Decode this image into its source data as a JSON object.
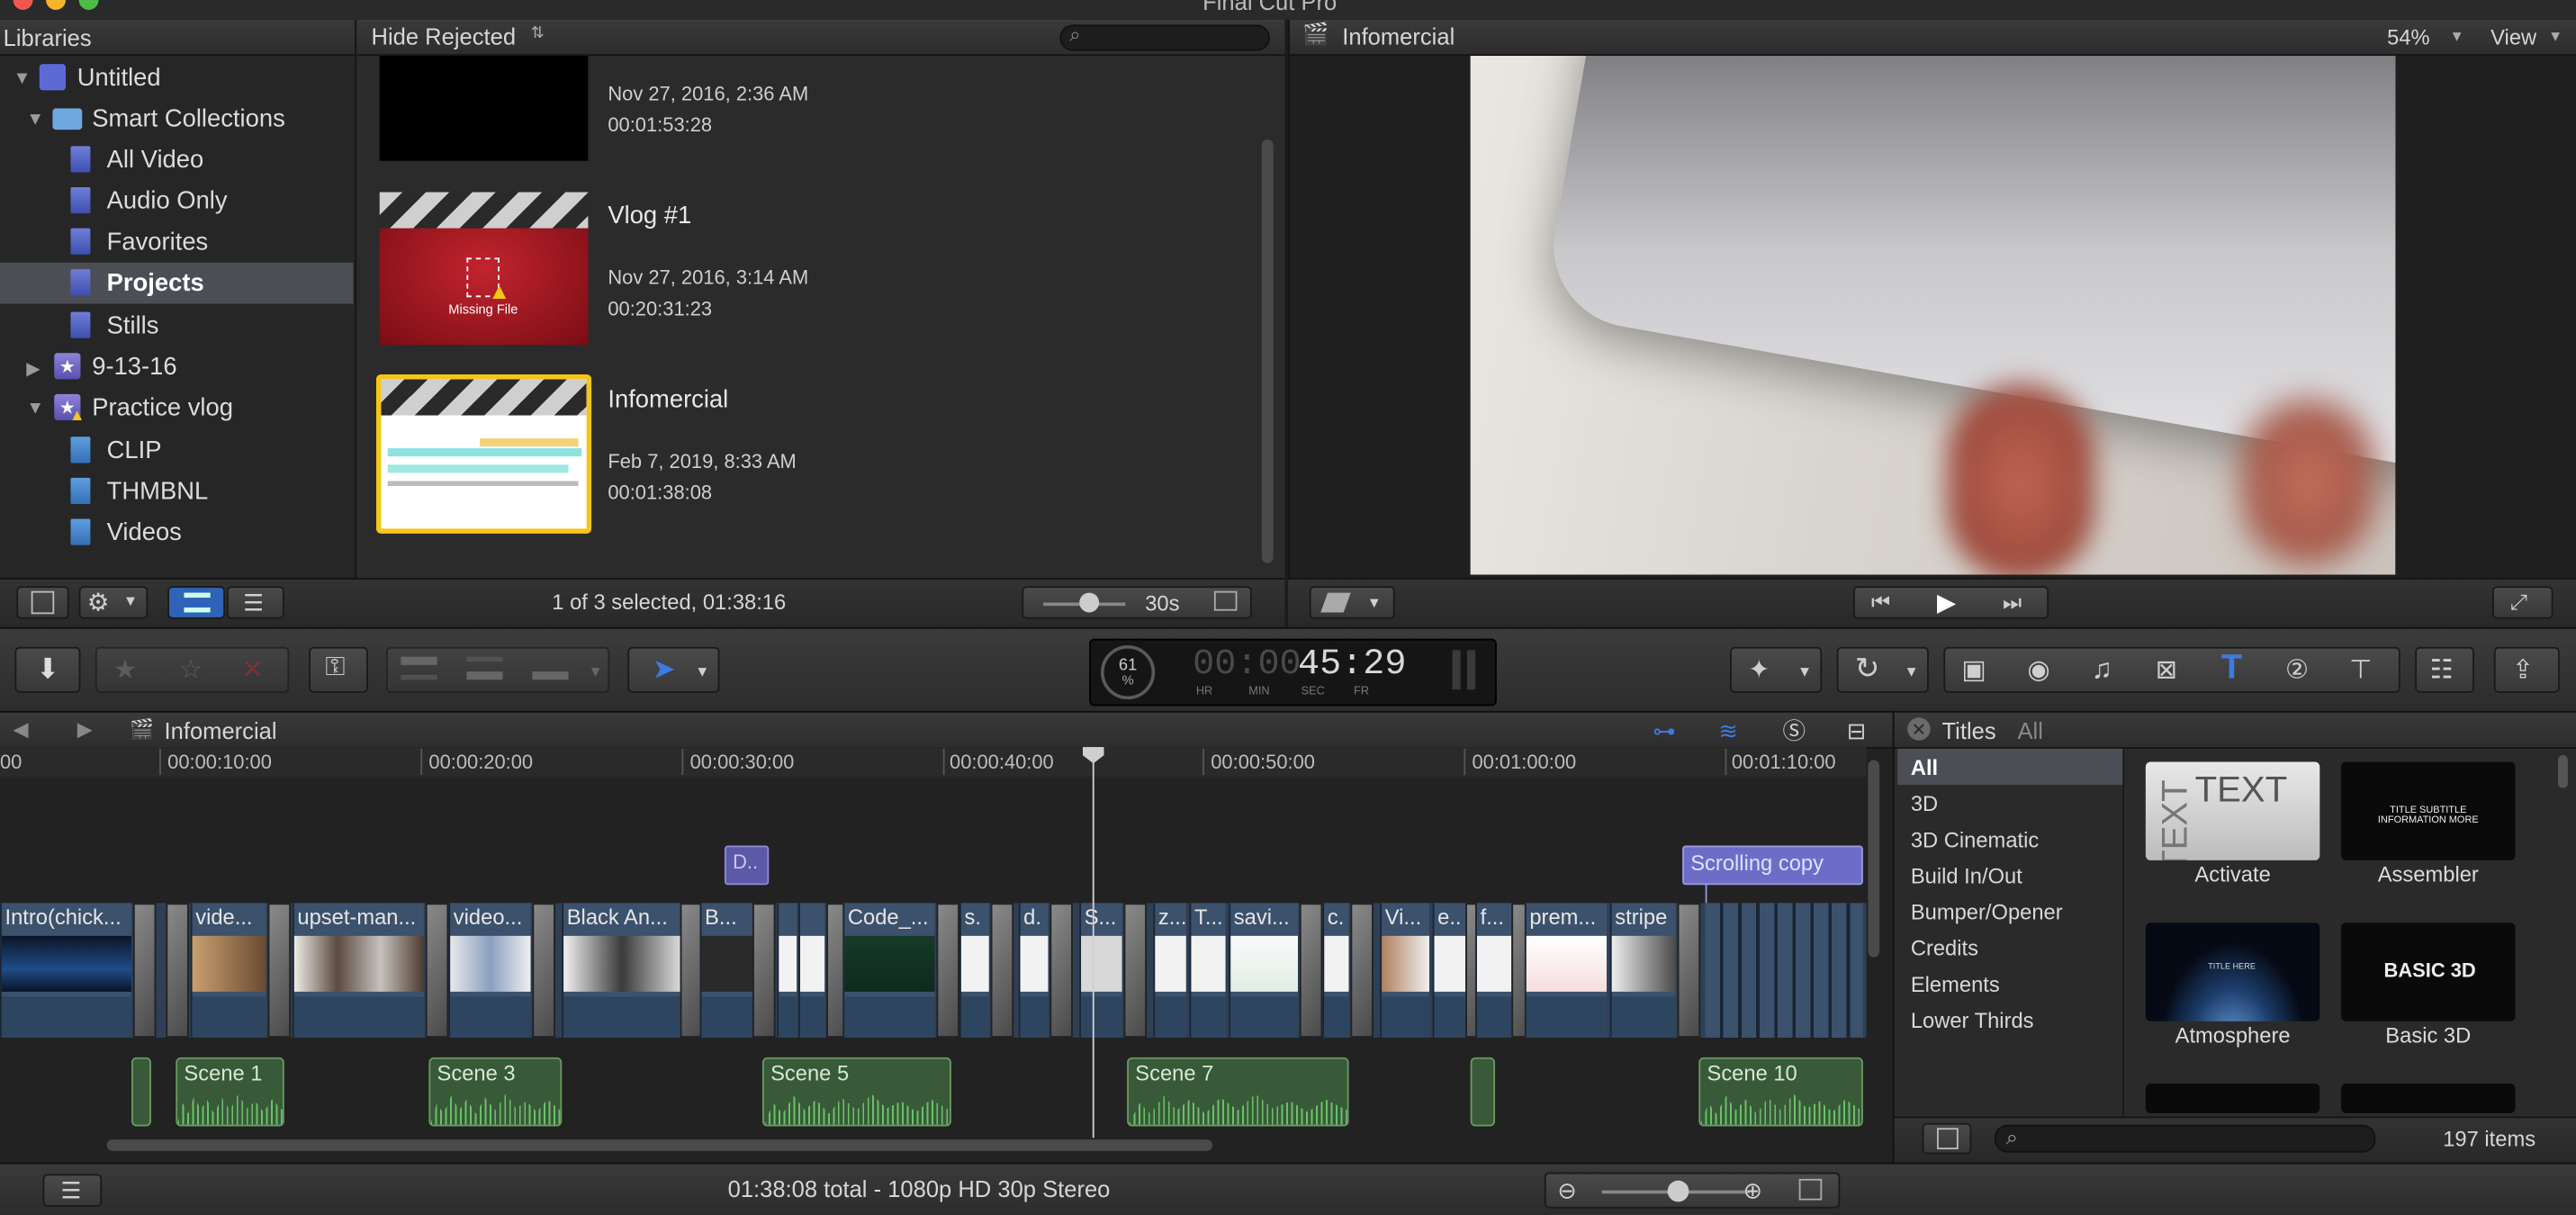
{
  "window": {
    "title": "Final Cut Pro"
  },
  "libraries": {
    "header": "Libraries",
    "items": [
      {
        "label": "Untitled"
      },
      {
        "label": "Smart Collections"
      },
      {
        "label": "All Video"
      },
      {
        "label": "Audio Only"
      },
      {
        "label": "Favorites"
      },
      {
        "label": "Projects"
      },
      {
        "label": "Stills"
      },
      {
        "label": "9-13-16"
      },
      {
        "label": "Practice vlog"
      },
      {
        "label": "CLIP"
      },
      {
        "label": "THMBNL"
      },
      {
        "label": "Videos"
      }
    ]
  },
  "browser": {
    "filter": "Hide Rejected",
    "clips": [
      {
        "name": "",
        "date": "Nov 27, 2016, 2:36 AM",
        "duration": "00:01:53:28"
      },
      {
        "name": "Vlog #1",
        "date": "Nov 27, 2016, 3:14 AM",
        "duration": "00:20:31:23",
        "badge": "Missing File"
      },
      {
        "name": "Infomercial",
        "date": "Feb 7, 2019, 8:33 AM",
        "duration": "00:01:38:08"
      }
    ],
    "status": "1 of 3 selected, 01:38:16",
    "zoom_label": "30s"
  },
  "viewer": {
    "title": "Infomercial",
    "zoom": "54%",
    "view_menu": "View"
  },
  "dashboard": {
    "percent": "61",
    "percent_unit": "%",
    "timecode_dim": "00:00:",
    "timecode": "45:29",
    "units": [
      "HR",
      "MIN",
      "SEC",
      "FR"
    ]
  },
  "timeline": {
    "title": "Infomercial",
    "ruler": [
      "00:00:10:00",
      "00:00:20:00",
      "00:00:30:00",
      "00:00:40:00",
      "00:00:50:00",
      "00:01:00:00",
      "00:01:10:00"
    ],
    "ruler_start": "00",
    "clips": [
      "Intro(chick...",
      "vide...",
      "upset-man...",
      "video...",
      "Black An...",
      "B...",
      "Code_...",
      "s.",
      "d.",
      "S...",
      "z...",
      "T...",
      "savi...",
      "c.",
      "Vi...",
      "e..",
      "f...",
      "prem...",
      "stripe"
    ],
    "connected": [
      "D..",
      "Scrolling copy"
    ],
    "audio": [
      "Scene 1",
      "Scene 3",
      "Scene 5",
      "Scene 7",
      "Scene 10"
    ],
    "status": "01:38:08 total - 1080p HD 30p Stereo"
  },
  "titles": {
    "header": "Titles",
    "filter": "All",
    "categories": [
      "All",
      "3D",
      "3D Cinematic",
      "Build In/Out",
      "Bumper/Opener",
      "Credits",
      "Elements",
      "Lower Thirds"
    ],
    "items": [
      {
        "name": "Activate",
        "preview_text": "TEXT"
      },
      {
        "name": "Assembler",
        "preview_text": "TITLE SUBTITLE INFORMATION MORE"
      },
      {
        "name": "Atmosphere",
        "preview_text": "TITLE HERE"
      },
      {
        "name": "Basic 3D",
        "preview_text": "BASIC 3D"
      }
    ],
    "count": "197 items"
  },
  "colors": {
    "accent": "#3d7be0",
    "selection": "#f5c518",
    "audio": "#385a38",
    "video": "#3c516c"
  }
}
